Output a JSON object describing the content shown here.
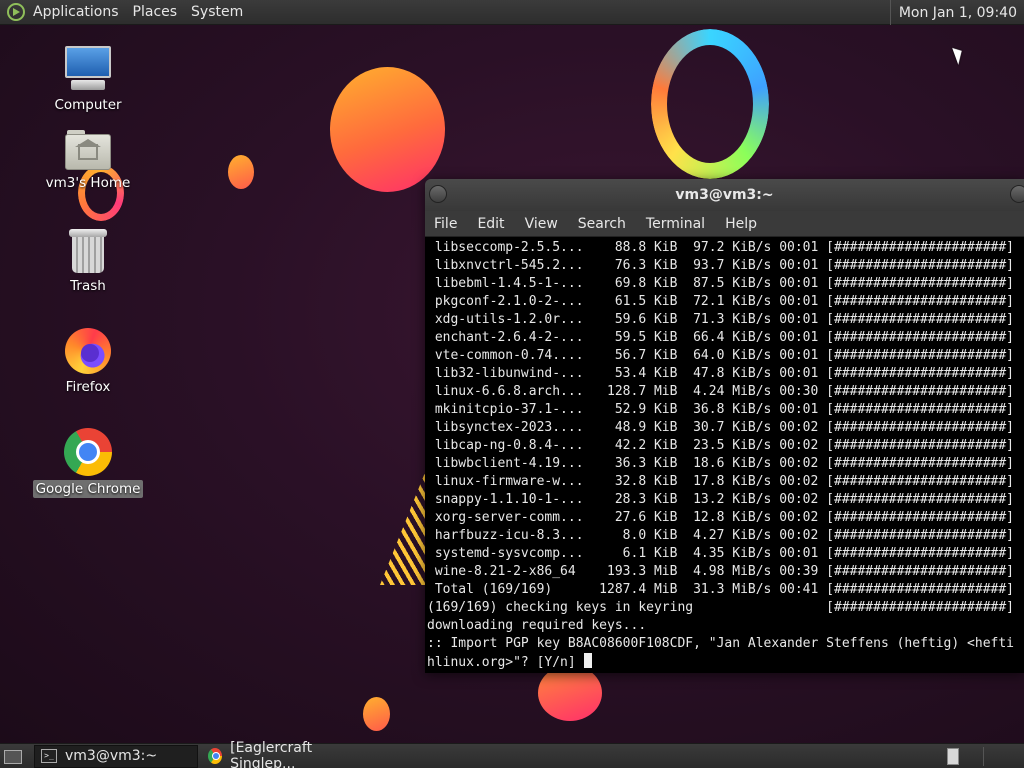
{
  "top_panel": {
    "menus": [
      "Applications",
      "Places",
      "System"
    ],
    "clock": "Mon Jan 1, 09:40"
  },
  "desktop_icons": [
    {
      "label": "Computer",
      "icon": "computer-icon"
    },
    {
      "label": "vm3's Home",
      "icon": "home-folder-icon"
    },
    {
      "label": "Trash",
      "icon": "trash-icon"
    },
    {
      "label": "Firefox",
      "icon": "firefox-icon"
    },
    {
      "label": "Google Chrome",
      "icon": "chrome-icon",
      "selected": true
    }
  ],
  "terminal": {
    "title": "vm3@vm3:~",
    "menu": [
      "File",
      "Edit",
      "View",
      "Search",
      "Terminal",
      "Help"
    ],
    "lines": [
      " libseccomp-2.5.5...    88.8 KiB  97.2 KiB/s 00:01 [######################]",
      " libxnvctrl-545.2...    76.3 KiB  93.7 KiB/s 00:01 [######################]",
      " libebml-1.4.5-1-...    69.8 KiB  87.5 KiB/s 00:01 [######################]",
      " pkgconf-2.1.0-2-...    61.5 KiB  72.1 KiB/s 00:01 [######################]",
      " xdg-utils-1.2.0r...    59.6 KiB  71.3 KiB/s 00:01 [######################]",
      " enchant-2.6.4-2-...    59.5 KiB  66.4 KiB/s 00:01 [######################]",
      " vte-common-0.74....    56.7 KiB  64.0 KiB/s 00:01 [######################]",
      " lib32-libunwind-...    53.4 KiB  47.8 KiB/s 00:01 [######################]",
      " linux-6.6.8.arch...   128.7 MiB  4.24 MiB/s 00:30 [######################]",
      " mkinitcpio-37.1-...    52.9 KiB  36.8 KiB/s 00:01 [######################]",
      " libsynctex-2023....    48.9 KiB  30.7 KiB/s 00:02 [######################]",
      " libcap-ng-0.8.4-...    42.2 KiB  23.5 KiB/s 00:02 [######################]",
      " libwbclient-4.19...    36.3 KiB  18.6 KiB/s 00:02 [######################]",
      " linux-firmware-w...    32.8 KiB  17.8 KiB/s 00:02 [######################]",
      " snappy-1.1.10-1-...    28.3 KiB  13.2 KiB/s 00:02 [######################]",
      " xorg-server-comm...    27.6 KiB  12.8 KiB/s 00:02 [######################]",
      " harfbuzz-icu-8.3...     8.0 KiB  4.27 KiB/s 00:02 [######################]",
      " systemd-sysvcomp...     6.1 KiB  4.35 KiB/s 00:01 [######################]",
      " wine-8.21-2-x86_64    193.3 MiB  4.98 MiB/s 00:39 [######################]",
      " Total (169/169)      1287.4 MiB  31.3 MiB/s 00:41 [######################]",
      "(169/169) checking keys in keyring                 [######################]",
      "downloading required keys...",
      ":: Import PGP key B8AC08600F108CDF, \"Jan Alexander Steffens (heftig) <hefti",
      "hlinux.org>\"? [Y/n] "
    ]
  },
  "taskbar": {
    "tasks": [
      {
        "label": "vm3@vm3:~",
        "active": true
      },
      {
        "label": "[Eaglercraft Singlep...",
        "active": false
      }
    ]
  }
}
